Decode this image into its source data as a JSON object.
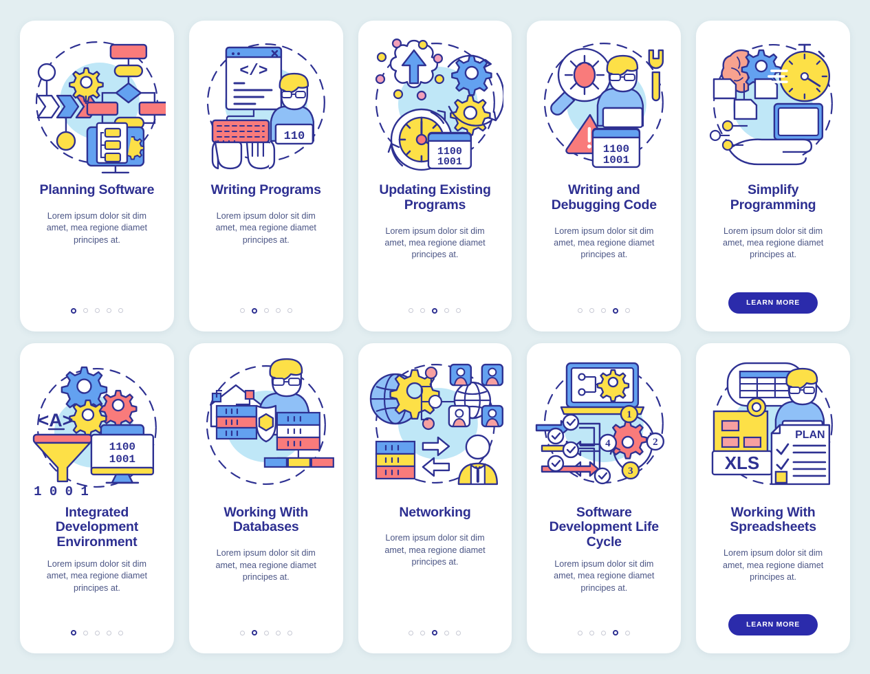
{
  "page": {
    "background_color": "#e3eef1",
    "card_background": "#ffffff",
    "title_color": "#2d2f91",
    "body_color": "#4b5585",
    "accent_button_color": "#2b2bab",
    "dot_active_color": "#2d2f91",
    "dot_inactive_color": "#c7c9d4",
    "illustration_palette": {
      "circle_bg": "#bfe7f7",
      "outline": "#2e3192",
      "yellow": "#fde047",
      "yellow_deep": "#fbd34d",
      "coral": "#f97b7b",
      "blue": "#63a1f0",
      "blue_light": "#8fc0f7",
      "pink": "#f2a0b8"
    }
  },
  "shared": {
    "description": "Lorem ipsum dolor sit dim amet, mea regione diamet principes at.",
    "cta_label": "LEARN MORE",
    "dot_count": 5
  },
  "cards": [
    {
      "id": "planning-software",
      "title": "Planning Software",
      "description": "Lorem ipsum dolor sit dim amet, mea regione diamet principes at.",
      "active_dot": 0,
      "has_cta": false,
      "illustration": "flowchart-gear-monitor-icon"
    },
    {
      "id": "writing-programs",
      "title": "Writing Programs",
      "description": "Lorem ipsum dolor sit dim amet, mea regione diamet principes at.",
      "active_dot": 1,
      "has_cta": false,
      "illustration": "code-window-keyboard-developer-icon",
      "illustration_text": [
        "110"
      ]
    },
    {
      "id": "updating-existing-programs",
      "title": "Updating Existing Programs",
      "description": "Lorem ipsum dolor sit dim amet, mea regione diamet principes at.",
      "active_dot": 2,
      "has_cta": false,
      "illustration": "upgrade-arrow-gears-clock-icon",
      "illustration_text": [
        "1100",
        "1001"
      ]
    },
    {
      "id": "writing-and-debugging-code",
      "title": "Writing and Debugging Code",
      "description": "Lorem ipsum dolor sit dim amet, mea regione diamet principes at.",
      "active_dot": 3,
      "has_cta": false,
      "illustration": "bug-magnifier-developer-wrench-icon",
      "illustration_text": [
        "1100",
        "1001"
      ]
    },
    {
      "id": "simplify-programming",
      "title": "Simplify Programming",
      "description": "Lorem ipsum dolor sit dim amet, mea regione diamet principes at.",
      "active_dot": -1,
      "has_cta": true,
      "cta_label": "LEARN MORE",
      "illustration": "brain-gear-stopwatch-hand-monitor-icon"
    },
    {
      "id": "integrated-development-environment",
      "title": "Integrated Development Environment",
      "description": "Lorem ipsum dolor sit dim amet, mea regione diamet principes at.",
      "active_dot": 0,
      "has_cta": false,
      "illustration": "funnel-gears-monitor-binary-icon",
      "illustration_text": [
        "A",
        "1100",
        "1001",
        "1 0 0 1"
      ]
    },
    {
      "id": "working-with-databases",
      "title": "Working With Databases",
      "description": "Lorem ipsum dolor sit dim amet, mea regione diamet principes at.",
      "active_dot": 1,
      "has_cta": false,
      "illustration": "database-servers-shield-developer-icon"
    },
    {
      "id": "networking",
      "title": "Networking",
      "description": "Lorem ipsum dolor sit dim amet, mea regione diamet principes at.",
      "active_dot": 2,
      "has_cta": false,
      "illustration": "globe-gear-users-server-exchange-icon"
    },
    {
      "id": "software-development-life-cycle",
      "title": "Software Development Life Cycle",
      "description": "Lorem ipsum dolor sit dim amet, mea regione diamet principes at.",
      "active_dot": 3,
      "has_cta": false,
      "illustration": "laptop-checklist-cycle-gear-icon",
      "illustration_text": [
        "1",
        "2",
        "3",
        "4"
      ]
    },
    {
      "id": "working-with-spreadsheets",
      "title": "Working With Spreadsheets",
      "description": "Lorem ipsum dolor sit dim amet, mea regione diamet principes at.",
      "active_dot": -1,
      "has_cta": true,
      "cta_label": "LEARN MORE",
      "illustration": "spreadsheet-xls-plan-developer-icon",
      "illustration_text": [
        "XLS",
        "PLAN"
      ]
    }
  ]
}
